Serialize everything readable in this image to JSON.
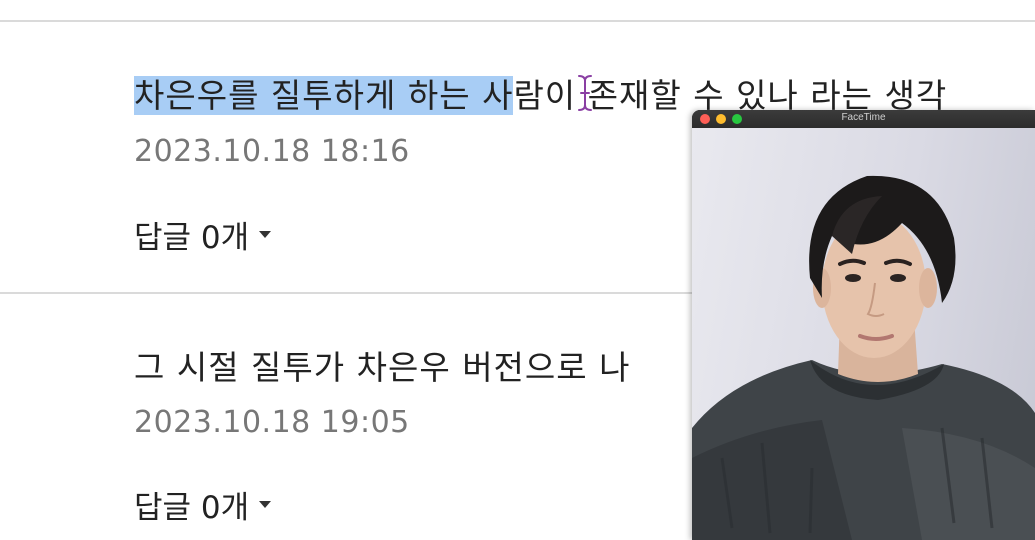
{
  "comments": [
    {
      "text_selected": "차은우를 질투하게 하는 사",
      "text_rest": "람이 존재할 수 있나 라는 생각",
      "date": "2023.10.18  18:16",
      "reply_label": "답글 0개"
    },
    {
      "text": "그 시절 질투가 차은우 버전으로 나",
      "date": "2023.10.18  19:05",
      "reply_label": "답글 0개"
    }
  ],
  "facetime": {
    "title": "FaceTime",
    "controls": [
      {
        "name": "close-button",
        "color": "#ff5f57"
      },
      {
        "name": "minimize-button",
        "color": "#febc2e"
      },
      {
        "name": "zoom-button",
        "color": "#28c840"
      }
    ]
  }
}
